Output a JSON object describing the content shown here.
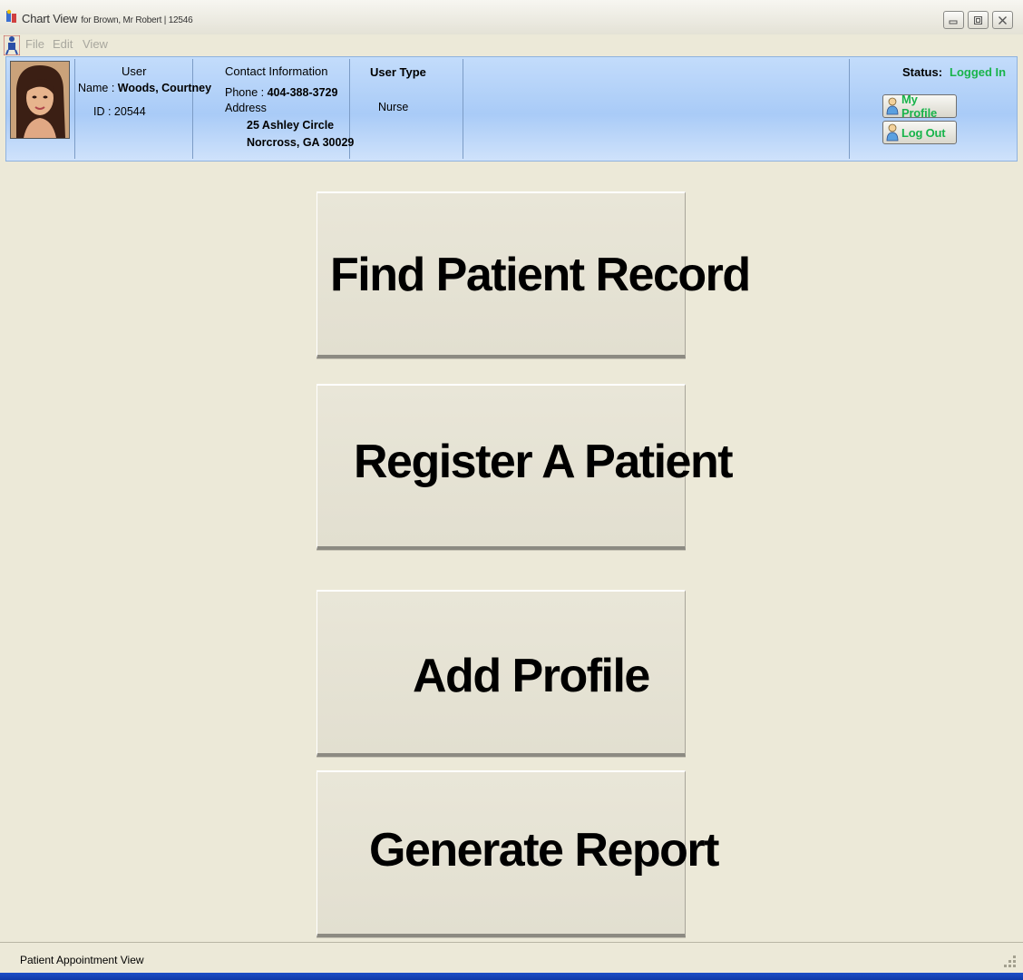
{
  "window": {
    "title": "Chart View",
    "subtitle": "for Brown, Mr Robert | 12546",
    "controls": [
      "minimize-icon",
      "restore-icon",
      "close-icon"
    ]
  },
  "menu": {
    "items": [
      "File",
      "Edit",
      "View"
    ]
  },
  "header": {
    "user": {
      "heading": "User",
      "name_label": "Name :",
      "name_value": "Woods, Courtney",
      "id_text": "ID : 20544"
    },
    "contact": {
      "heading": "Contact Information",
      "phone_label": "Phone :",
      "phone_value": "404-388-3729",
      "address_label": "Address",
      "address_line1": "25 Ashley Circle",
      "address_line2": "Norcross, GA 30029"
    },
    "user_type": {
      "heading": "User Type",
      "value": "Nurse"
    },
    "status": {
      "label": "Status:",
      "value": "Logged In",
      "value_color": "#19b44b"
    },
    "buttons": {
      "my_profile": "My Profile",
      "log_out": "Log Out"
    }
  },
  "actions": {
    "find_patient": "Find Patient Record",
    "register_patient": "Register A Patient",
    "add_profile": "Add Profile",
    "generate_report": "Generate Report"
  },
  "statusbar": {
    "text": "Patient Appointment View"
  },
  "colors": {
    "background": "#ece9d8",
    "header_blue": "#a9cbf7",
    "accent_green": "#19b44b",
    "taskbar_blue": "#1d4fc7"
  }
}
